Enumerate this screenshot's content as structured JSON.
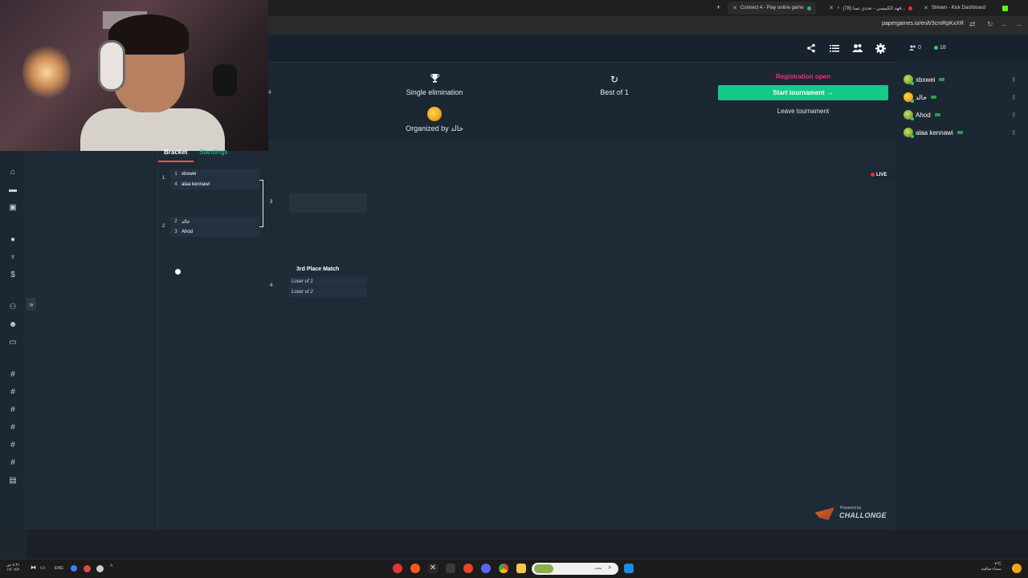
{
  "browser": {
    "tabs": [
      {
        "label": "Connect 4 - Play online game",
        "active": true
      },
      {
        "label": "(78) فهد الكبيسي - تحدي تسا...",
        "active": false
      },
      {
        "label": "Stream - Kick Dashboard",
        "active": false
      }
    ],
    "url": "papergames.io/en/t/3cmRpKxXR"
  },
  "info": {
    "stray_number": "4",
    "format_label": "Single elimination",
    "organized_by": "Organized by خالد",
    "best_of_label": "Best of 1",
    "registration_status": "Registration open",
    "start_button": "Start tournament",
    "start_arrow": "→",
    "leave_button": "Leave tournament"
  },
  "bracket": {
    "tab_bracket": "Bracket",
    "tab_standings": "Standings",
    "round1": [
      {
        "match": "1",
        "players": [
          {
            "seed": "1",
            "name": "xbxwei"
          },
          {
            "seed": "4",
            "name": "alaa kennawi"
          }
        ]
      },
      {
        "match": "2",
        "players": [
          {
            "seed": "2",
            "name": "خالد"
          },
          {
            "seed": "3",
            "name": "Ahod"
          }
        ]
      }
    ],
    "final_match_number": "3",
    "third_place": {
      "title": "3rd Place Match",
      "match": "4",
      "slots": [
        "Loser of 1",
        "Loser of 2"
      ]
    },
    "live_label": "LIVE"
  },
  "powered_by": {
    "top": "Powered by",
    "name": "CHALLONGE"
  },
  "players_panel": {
    "count_people": "0",
    "count_online": "18",
    "players": [
      "xbxwei",
      "خالد",
      "Ahod",
      "alaa kennawi"
    ]
  },
  "taskbar": {
    "lang": "ENG",
    "search_placeholder": "بحث",
    "weather_temp": "٣°C",
    "weather_text": "سماء صافية",
    "clock_time": "٤:٣١ ص",
    "clock_date": "١٧/٠٧/٢٠"
  },
  "colors": {
    "accent_green": "#14c98a",
    "registration_pink": "#f0307a",
    "tab_underline": "#ff5a2c",
    "standings_teal": "#25c6a2",
    "live_red": "#ff2b2b"
  },
  "icons": [
    "trophy-icon",
    "refresh-icon",
    "share-icon",
    "list-icon",
    "users-icon",
    "gear-icon",
    "home-icon",
    "cart-icon",
    "gift-icon",
    "hash-icon",
    "trash-icon",
    "arrow-right-icon",
    "expand-icon"
  ]
}
